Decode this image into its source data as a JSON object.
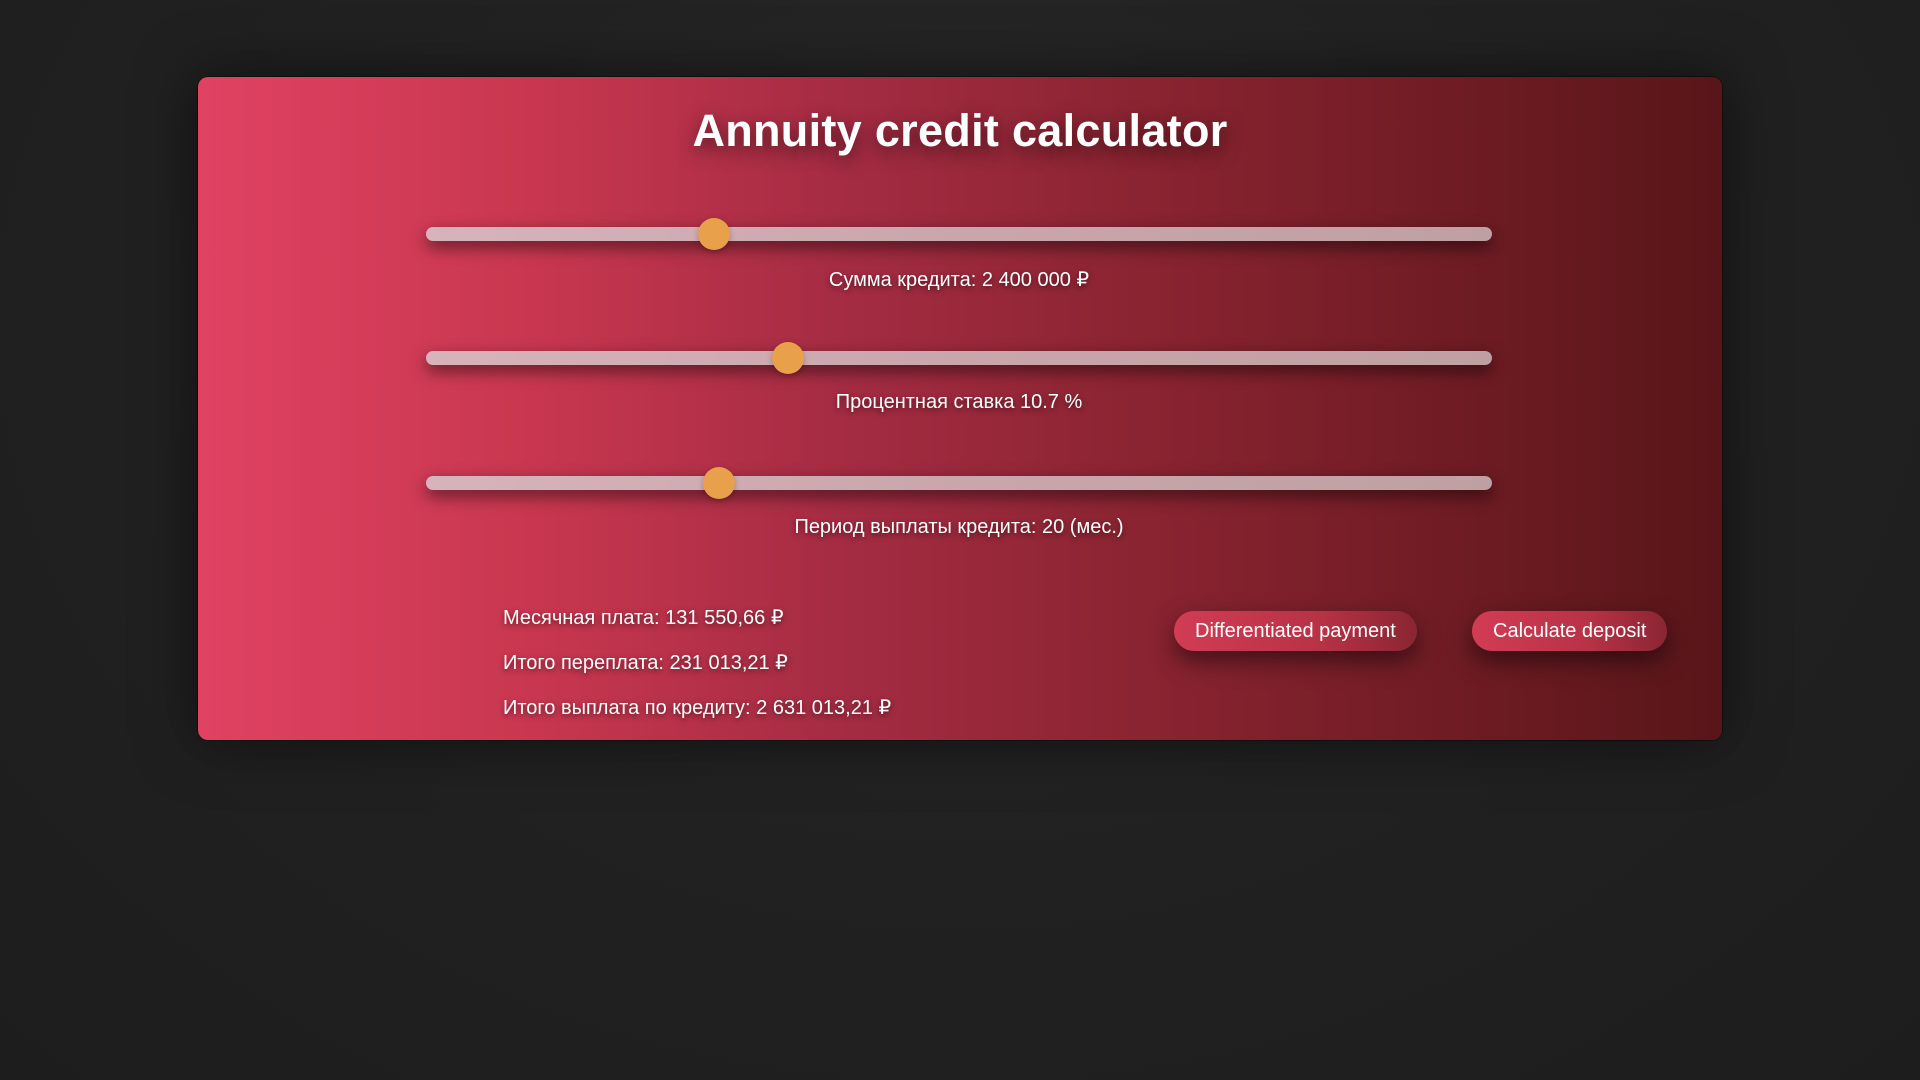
{
  "app": {
    "title": "Annuity credit calculator"
  },
  "sliders": [
    {
      "label": "Сумма кредита: 2 400 000 ₽",
      "level_fraction": 0.27
    },
    {
      "label": "Процентная ставка 10.7 %",
      "level_fraction": 0.34
    },
    {
      "label": "Период выплаты кредита: 20 (мес.)",
      "level_fraction": 0.275
    }
  ],
  "results": {
    "monthly": "Месячная плата: 131 550,66 ₽",
    "overpayment": "Итого переплата: 231 013,21 ₽",
    "total": "Итого выплата по кредиту: 2 631 013,21 ₽"
  },
  "buttons": {
    "differentiated": "Differentiated payment",
    "deposit": "Calculate deposit"
  },
  "colors": {
    "thumb": "#e8a04b",
    "card_start": "#e04262",
    "card_end": "#581619",
    "page_background": "#222222"
  }
}
